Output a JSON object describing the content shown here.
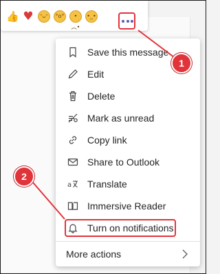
{
  "reactions": [
    {
      "name": "like",
      "glyph": "👍"
    },
    {
      "name": "heart",
      "glyph": "♥"
    },
    {
      "name": "laugh",
      "glyph": "ᵔᴗᵔ"
    },
    {
      "name": "surprised",
      "glyph": "°o°"
    },
    {
      "name": "sad",
      "glyph": "•︵•"
    },
    {
      "name": "angry",
      "glyph": "•_•"
    }
  ],
  "more_options_icon": "more-options-icon",
  "menu": {
    "items": [
      {
        "label": "Save this message",
        "icon": "bookmark-icon"
      },
      {
        "label": "Edit",
        "icon": "pencil-icon"
      },
      {
        "label": "Delete",
        "icon": "trash-icon"
      },
      {
        "label": "Mark as unread",
        "icon": "unread-icon"
      },
      {
        "label": "Copy link",
        "icon": "link-icon"
      },
      {
        "label": "Share to Outlook",
        "icon": "mail-icon"
      },
      {
        "label": "Translate",
        "icon": "translate-icon"
      },
      {
        "label": "Immersive Reader",
        "icon": "book-icon"
      },
      {
        "label": "Turn on notifications",
        "icon": "bell-icon"
      }
    ],
    "more_actions": "More actions"
  },
  "callouts": [
    "1",
    "2"
  ],
  "colors": {
    "accent_red": "#e0333a",
    "brand_purple": "#5c5ca8",
    "text": "#242424"
  }
}
